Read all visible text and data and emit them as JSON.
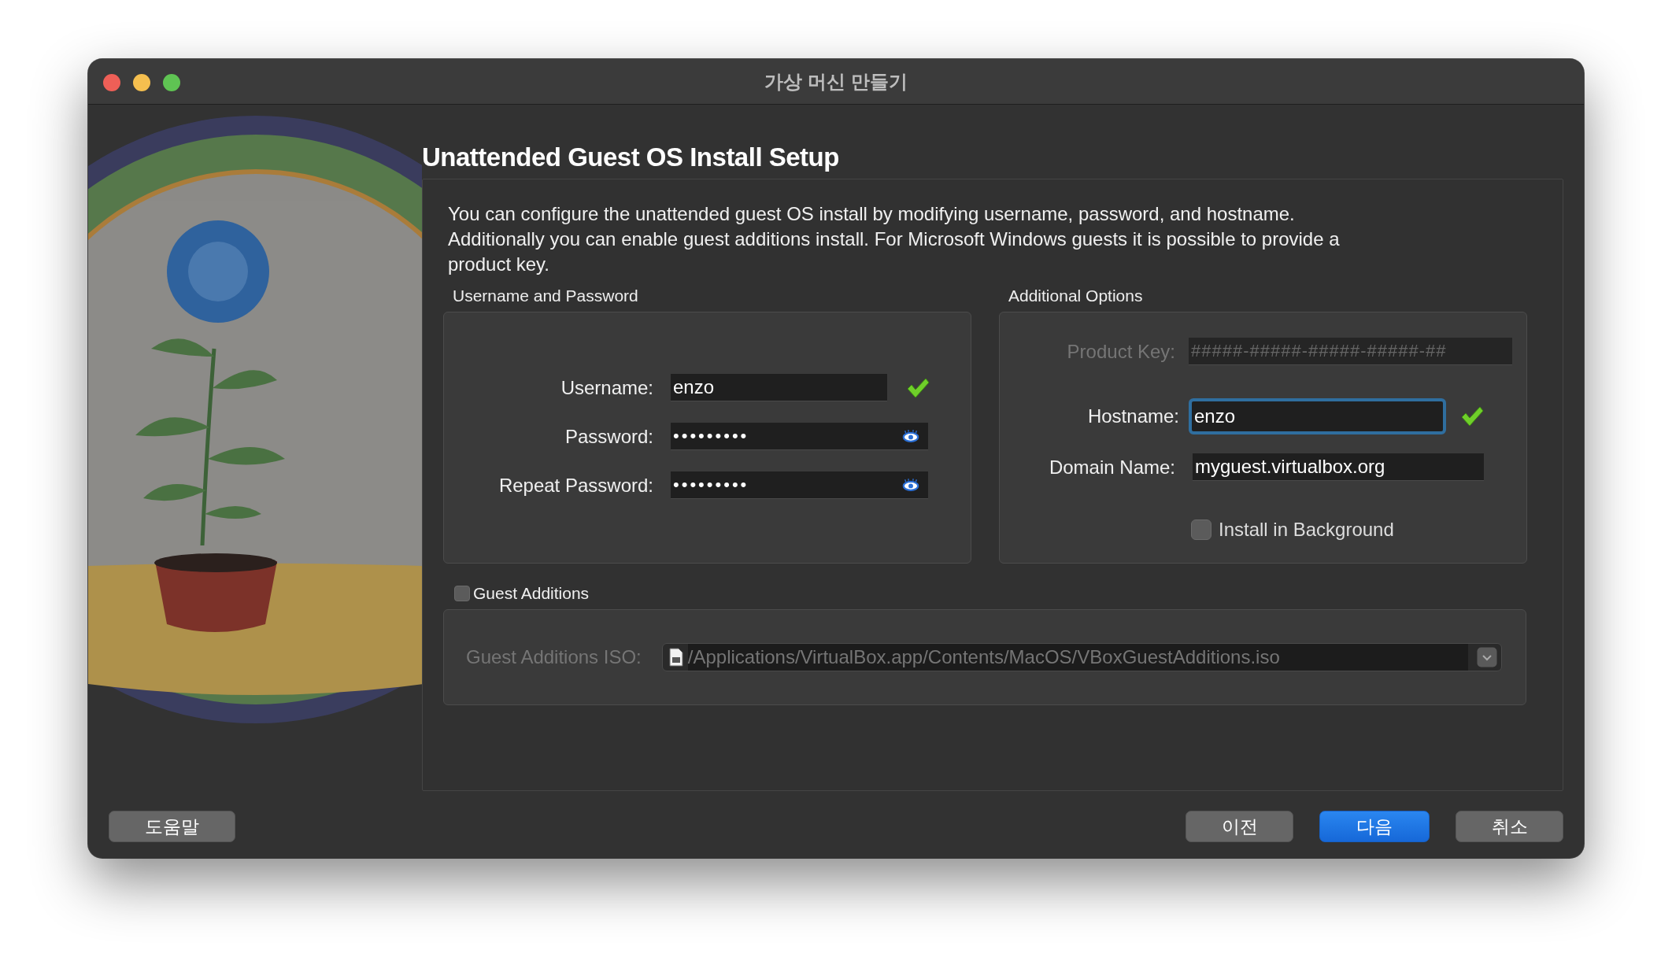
{
  "window": {
    "title": "가상 머신 만들기"
  },
  "page_title": "Unattended Guest OS Install Setup",
  "description": "You can configure the unattended guest OS install by modifying username, password, and hostname. Additionally you can enable guest additions install. For Microsoft Windows guests it is possible to provide a product key.",
  "credentials": {
    "title": "Username and Password",
    "fields": [
      {
        "label": "Username:",
        "value": "enzo",
        "kind": "text",
        "valid": true
      },
      {
        "label": "Password:",
        "value": "•••••••••",
        "kind": "password"
      },
      {
        "label": "Repeat Password:",
        "value": "•••••••••",
        "kind": "password"
      }
    ]
  },
  "additional_options": {
    "title": "Additional Options",
    "product_key": {
      "label": "Product Key:",
      "placeholder": "#####-#####-#####-#####-##",
      "disabled": true
    },
    "hostname": {
      "label": "Hostname:",
      "value": "enzo",
      "focused": true,
      "valid": true
    },
    "domain_name": {
      "label": "Domain Name:",
      "value": "myguest.virtualbox.org"
    },
    "install_in_background": {
      "label": "Install in Background",
      "checked": false
    }
  },
  "guest_additions": {
    "label": "Guest Additions",
    "checked": false,
    "iso_label": "Guest Additions ISO:",
    "iso_path": "/Applications/VirtualBox.app/Contents/MacOS/VBoxGuestAdditions.iso",
    "disabled": true
  },
  "buttons": [
    {
      "label": "도움말",
      "kind": "help"
    },
    {
      "label": "이전",
      "kind": "back"
    },
    {
      "label": "다음",
      "kind": "next"
    },
    {
      "label": "취소",
      "kind": "cancel"
    }
  ]
}
